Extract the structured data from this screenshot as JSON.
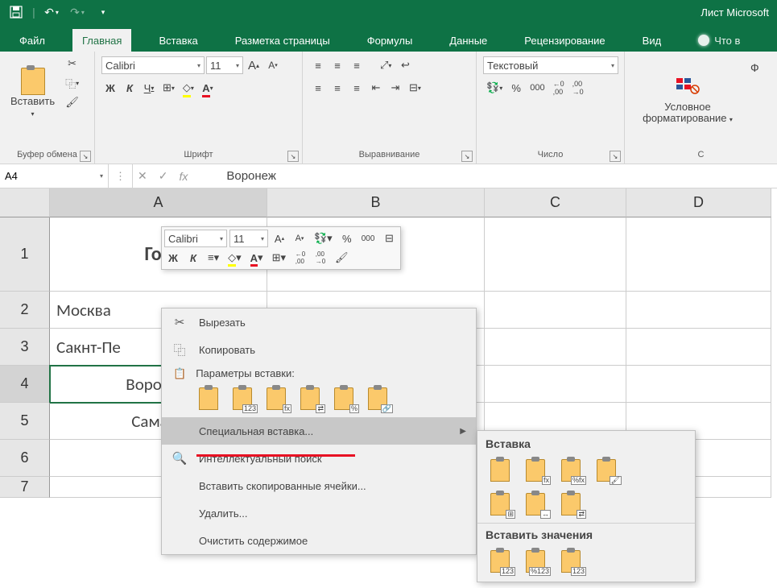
{
  "app": {
    "title": "Лист Microsoft"
  },
  "qat": {
    "save": "save",
    "undo": "undo",
    "redo": "redo"
  },
  "tabs": {
    "file": "Файл",
    "home": "Главная",
    "insert": "Вставка",
    "layout": "Разметка страницы",
    "formulas": "Формулы",
    "data": "Данные",
    "review": "Рецензирование",
    "view": "Вид",
    "tell": "Что в"
  },
  "ribbon": {
    "clipboard": {
      "paste": "Вставить",
      "label": "Буфер обмена"
    },
    "font": {
      "name": "Calibri",
      "size": "11",
      "label": "Шрифт"
    },
    "align": {
      "label": "Выравнивание"
    },
    "number": {
      "format": "Текстовый",
      "label": "Число"
    },
    "styles": {
      "cond": "Условное форматирование",
      "more": "Ф"
    }
  },
  "namebox": "A4",
  "formula_value": "Воронеж",
  "columns": {
    "A": "A",
    "B": "B",
    "C": "C",
    "D": "D"
  },
  "col_widths": {
    "A": 270,
    "B": 270,
    "C": 176,
    "D": 180
  },
  "rows": [
    "1",
    "2",
    "3",
    "4",
    "5",
    "6",
    "7"
  ],
  "cells": {
    "A1": "Гор",
    "A2": "Москва",
    "A3": "Сакнт-Пе",
    "A4": "Воронеж",
    "A5": "Самара"
  },
  "mini": {
    "font": "Calibri",
    "size": "11"
  },
  "ctx": {
    "cut": "Вырезать",
    "copy": "Копировать",
    "paste_opts": "Параметры вставки:",
    "special": "Специальная вставка...",
    "smart": "Интеллектуальный поиск",
    "insert_cells": "Вставить скопированные ячейки...",
    "delete": "Удалить...",
    "clear": "Очистить содержимое",
    "paste_subs": {
      "p1": "",
      "p2": "123",
      "p3": "fx",
      "p4": "%",
      "p5": "%",
      "p6": "∞"
    }
  },
  "submenu": {
    "title1": "Вставка",
    "title2": "Вставить значения",
    "subs": {
      "s1": "",
      "s2": "fx",
      "s3": "%fx",
      "s4": "",
      "r2a": "",
      "r2b": "",
      "r2c": "",
      "v1": "123",
      "v2": "%123",
      "v3": "123"
    }
  }
}
